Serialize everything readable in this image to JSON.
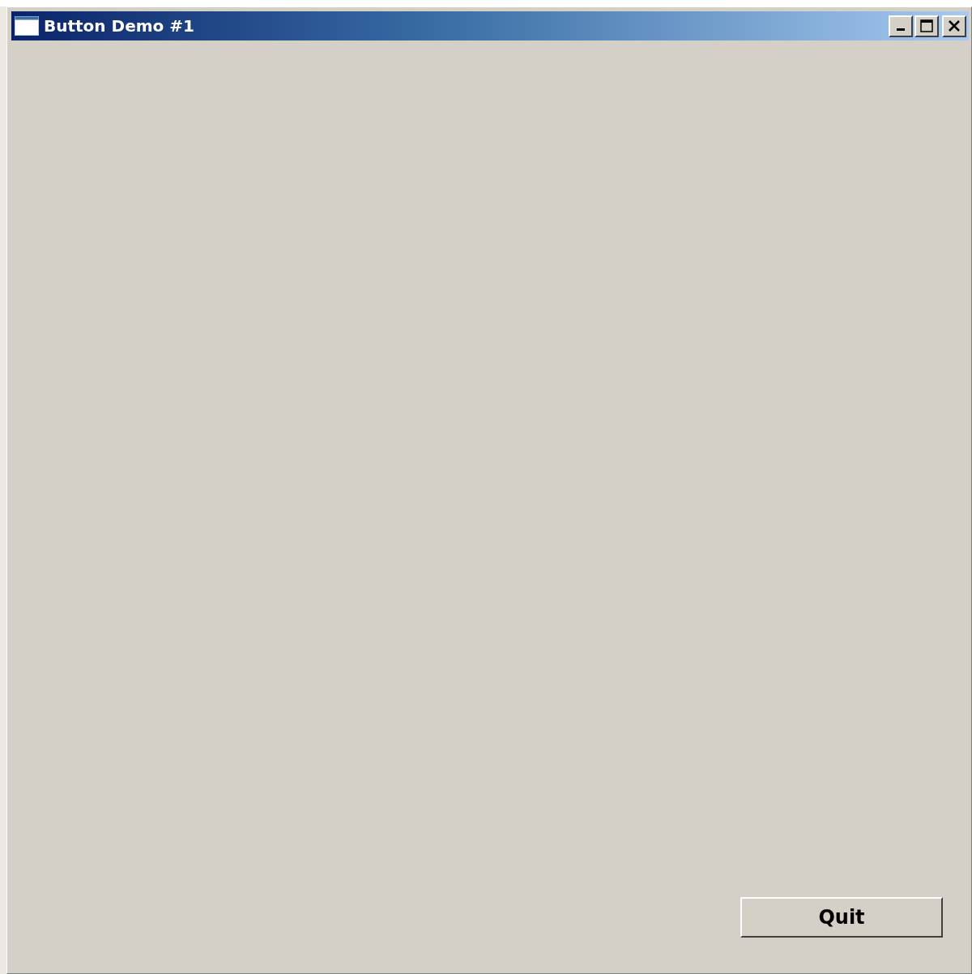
{
  "window": {
    "title": "Button Demo #1"
  },
  "buttons": [
    {
      "label": "Quit"
    }
  ]
}
